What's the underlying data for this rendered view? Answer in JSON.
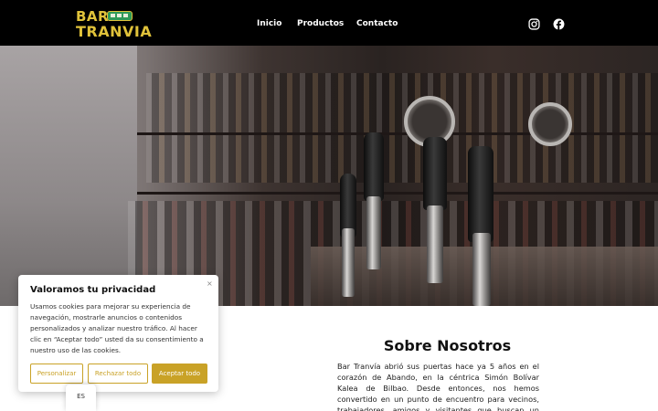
{
  "header": {
    "logo": {
      "line1": "BAR",
      "line2": "TRANVIA"
    },
    "nav": [
      {
        "label": "Inicio"
      },
      {
        "label": "Productos"
      },
      {
        "label": "Contacto"
      }
    ],
    "social": [
      {
        "icon": "instagram-icon"
      },
      {
        "icon": "facebook-icon"
      }
    ]
  },
  "cookie_banner": {
    "title": "Valoramos tu privacidad",
    "close_symbol": "×",
    "text": "Usamos cookies para mejorar su experiencia de navegación, mostrarle anuncios o contenidos personalizados y analizar nuestro tráfico. Al hacer clic en “Aceptar todo” usted da su consentimiento a nuestro uso de las cookies.",
    "buttons": {
      "customize": "Personalizar",
      "reject": "Rechazar todo",
      "accept": "Aceptar todo"
    }
  },
  "language": {
    "current": "ES"
  },
  "about": {
    "title": "Sobre Nosotros",
    "text": "Bar Tranvía abrió sus puertas hace ya 5 años en el corazón de Abando, en la céntrica Simón Bolívar Kalea de Bilbao. Desde entonces, nos hemos convertido en un punto de encuentro para vecinos, trabajadores, amigos y visitantes que buscan un lugar acogedor"
  },
  "colors": {
    "header_bg": "#000000",
    "brand_gold": "#c9a227",
    "logo_yellow": "#e0c23a",
    "tram_green": "#2f9a58"
  }
}
